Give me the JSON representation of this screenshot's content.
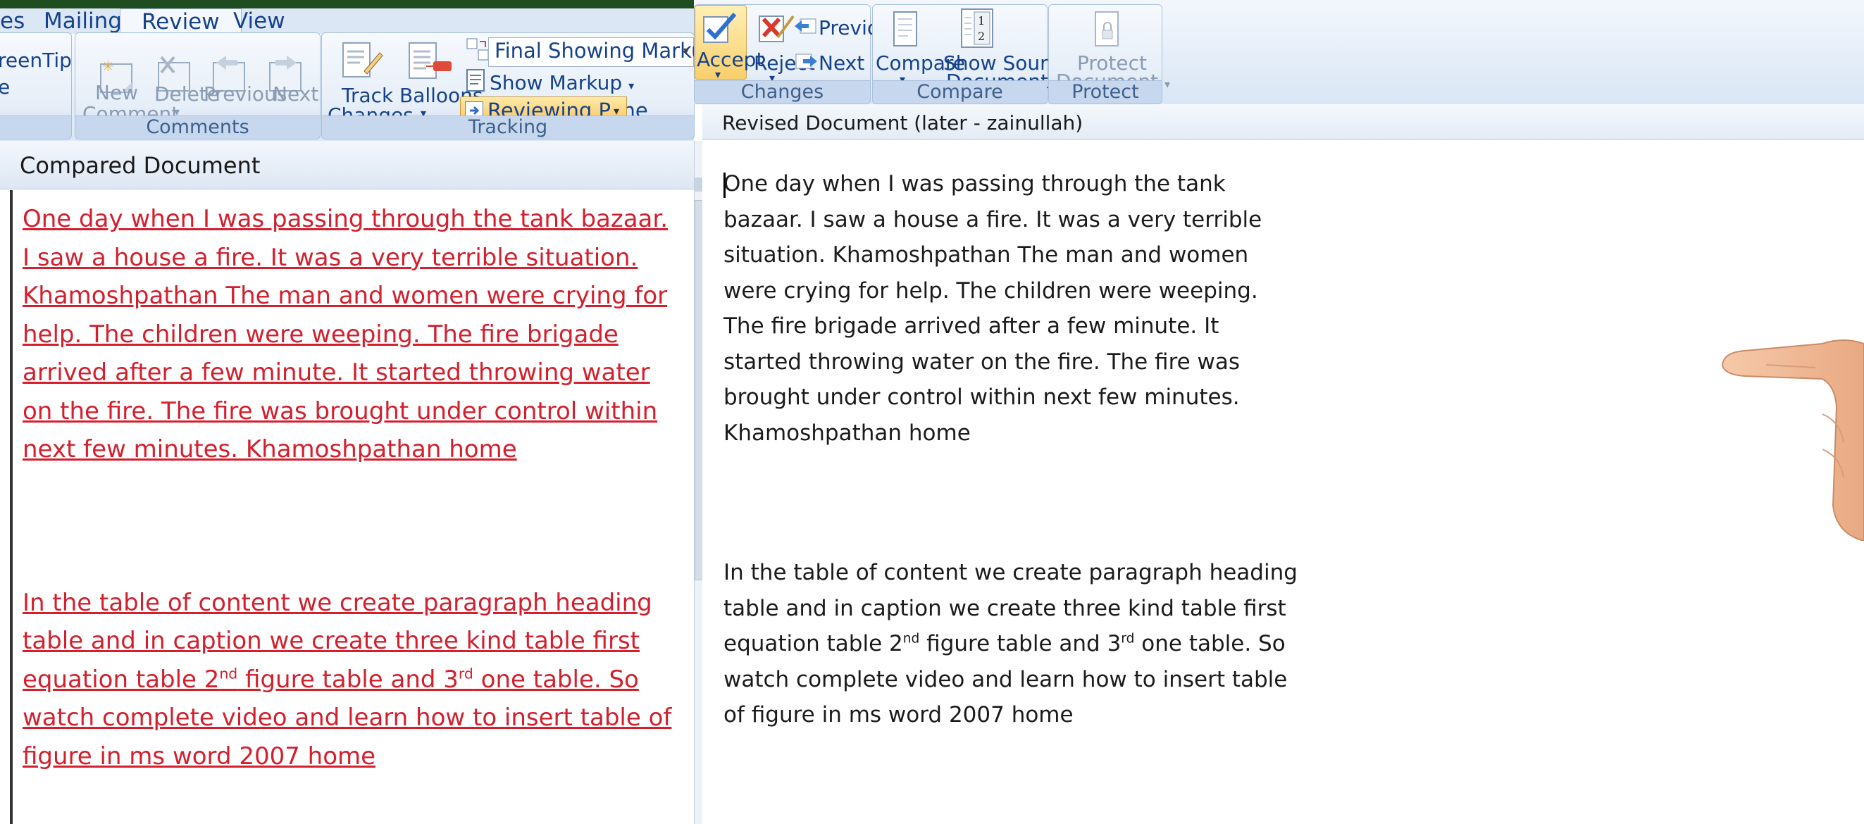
{
  "tabs": [
    {
      "label": "es"
    },
    {
      "label": "Mailings"
    },
    {
      "label": "Review"
    },
    {
      "label": "View"
    }
  ],
  "ribbon": {
    "screentip_partial": "reenTip",
    "partial_e": "e",
    "comments": {
      "new_line1": "New",
      "new_line2": "Comment",
      "delete": "Delete",
      "previous": "Previous",
      "next": "Next",
      "group_label": "Comments"
    },
    "tracking": {
      "track_changes_line1": "Track",
      "track_changes_line2": "Changes",
      "balloons": "Balloons",
      "display_select": "Final Showing Markup",
      "show_markup": "Show Markup",
      "reviewing_pane": "Reviewing Pane",
      "group_label": "Tracking"
    },
    "changes": {
      "accept": "Accept",
      "reject": "Reject",
      "previous": "Previous",
      "next": "Next",
      "group_label": "Changes"
    },
    "compare": {
      "compare": "Compare",
      "show_source_line1": "Show Source",
      "show_source_line2": "Documents",
      "group_label": "Compare",
      "source_icon_num1": "1",
      "source_icon_num2": "2"
    },
    "protect": {
      "protect_line1": "Protect",
      "protect_line2": "Document",
      "group_label": "Protect"
    }
  },
  "compared_pane": {
    "title": "Compared Document",
    "para1": "One day when I was passing through the tank bazaar. I saw a house a fire. It was a very terrible situation.   Khamoshpathan The man and women were crying for help. The children were weeping. The fire brigade arrived after a few minute. It started throwing water on the fire. The fire was brought under control within next few minutes. Khamoshpathan  home",
    "para2_part1": "In the table of content we create paragraph heading table and in caption we create three kind table first equation table 2",
    "sup_nd": "nd",
    "para2_part2": " figure table and 3",
    "sup_rd": "rd",
    "para2_part3": " one table. So watch complete video and learn how to insert table of figure in ms word 2007 home"
  },
  "revised_pane": {
    "title": "Revised Document (later - zainullah)",
    "para1": "One day when I was passing through the tank bazaar. I saw a house a fire. It was a very terrible situation. Khamoshpathan The man and women were crying for help. The children were weeping. The fire brigade arrived after a few minute. It started throwing water on the fire. The fire was brought under control within next few minutes. Khamoshpathan  home",
    "para2_part1": "In the table of content we create paragraph heading table and in caption we create three kind table first equation table 2",
    "sup_nd": "nd",
    "para2_part2": " figure table and 3",
    "sup_rd": "rd",
    "para2_part3": " one table. So watch complete video and learn how to insert table of figure in ms word 2007 home"
  },
  "colors": {
    "ribbon_text": "#15428b",
    "insert_text": "#d41f2d",
    "top_strip": "#1f4d1f"
  }
}
